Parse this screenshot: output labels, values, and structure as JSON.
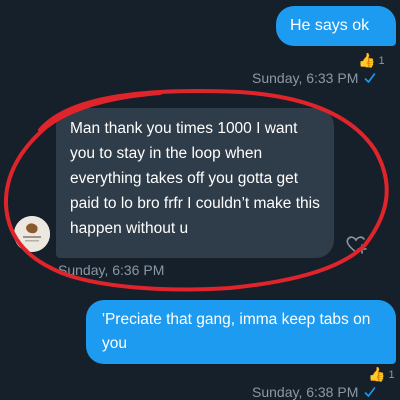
{
  "messages": [
    {
      "text": "He says ok",
      "reaction_count": "1",
      "timestamp": "Sunday, 6:33 PM"
    },
    {
      "text": "Man thank you times 1000 I want you to stay in the loop when everything takes off you gotta get paid to lo bro frfr I couldn’t make this happen without u",
      "timestamp": "Sunday, 6:36 PM"
    },
    {
      "text": "'Preciate that gang, imma keep tabs on you",
      "reaction_count": "1",
      "timestamp": "Sunday, 6:38 PM"
    }
  ],
  "colors": {
    "background": "#15202b",
    "outgoing_bubble": "#1d9bf0",
    "incoming_bubble": "#2f3c49",
    "timestamp_text": "#8b98a5",
    "annotation_circle": "#e0242b"
  },
  "icons": {
    "reaction": "thumbs-up-icon",
    "read_receipt": "check-icon",
    "add_reaction": "add-reaction-icon"
  }
}
